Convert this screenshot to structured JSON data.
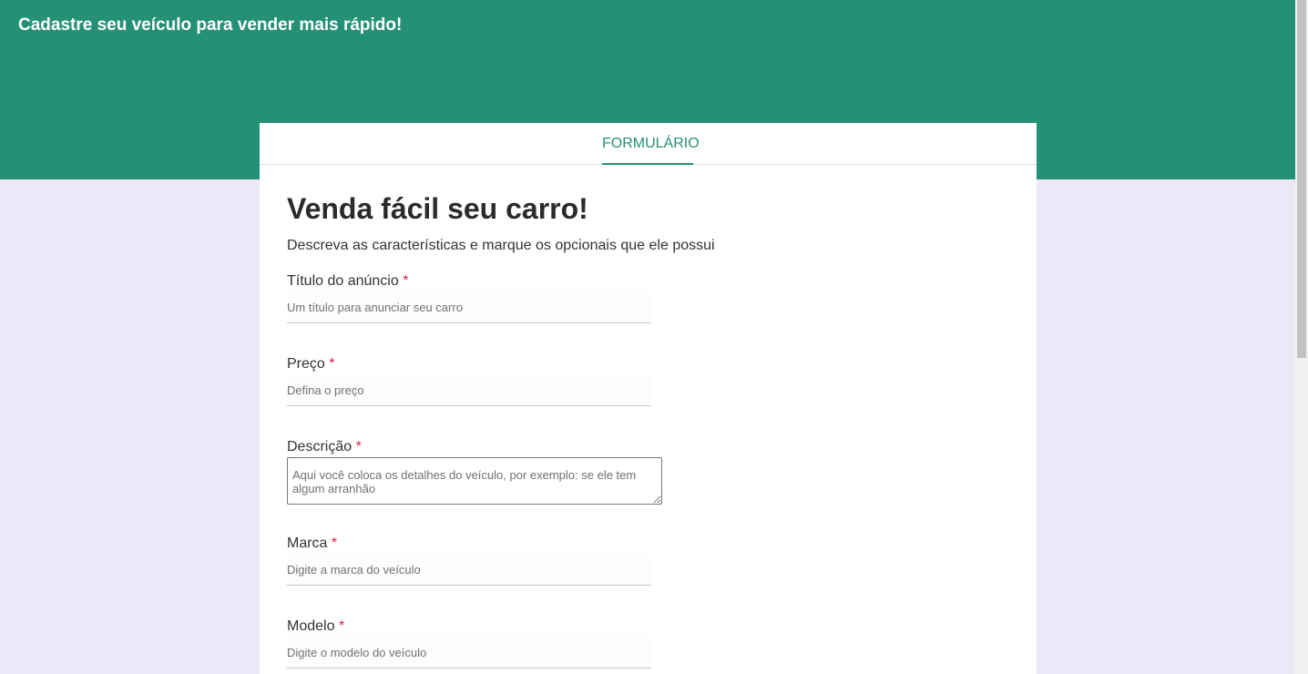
{
  "header": {
    "title": "Cadastre seu veículo para vender mais rápido!"
  },
  "tabs": [
    {
      "label": "FORMULÁRIO",
      "active": true
    }
  ],
  "form": {
    "title": "Venda fácil seu carro!",
    "subtitle": "Descreva as características e marque os opcionais que ele possui",
    "required_marker": "*",
    "fields": {
      "titulo": {
        "label": "Título do anúncio",
        "placeholder": "Um título para anunciar seu carro",
        "value": ""
      },
      "preco": {
        "label": "Preço",
        "placeholder": "Defina o preço",
        "value": ""
      },
      "descricao": {
        "label": "Descrição",
        "placeholder": "Aqui você coloca os detalhes do veículo, por exemplo: se ele tem algum arranhão",
        "value": ""
      },
      "marca": {
        "label": "Marca",
        "placeholder": "Digite a marca do veículo",
        "value": ""
      },
      "modelo": {
        "label": "Modelo",
        "placeholder": "Digite o modelo do veículo",
        "value": ""
      }
    }
  },
  "colors": {
    "accent": "#249176",
    "background": "#ede8f7",
    "required": "#d2244b"
  }
}
